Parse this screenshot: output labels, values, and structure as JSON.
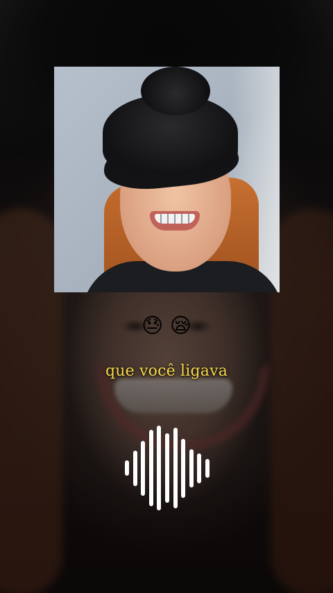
{
  "caption": {
    "lyric": "que você ligava"
  },
  "emojis": {
    "first": "😓",
    "second": "😪"
  },
  "colors": {
    "caption_text": "#f6d94a",
    "waveform": "#ffffff"
  },
  "waveform": {
    "icon": "audio-waveform-icon",
    "levels": [
      0.18,
      0.42,
      0.65,
      0.9,
      1.0,
      0.82,
      0.95,
      0.7,
      0.45,
      0.35,
      0.22
    ]
  }
}
